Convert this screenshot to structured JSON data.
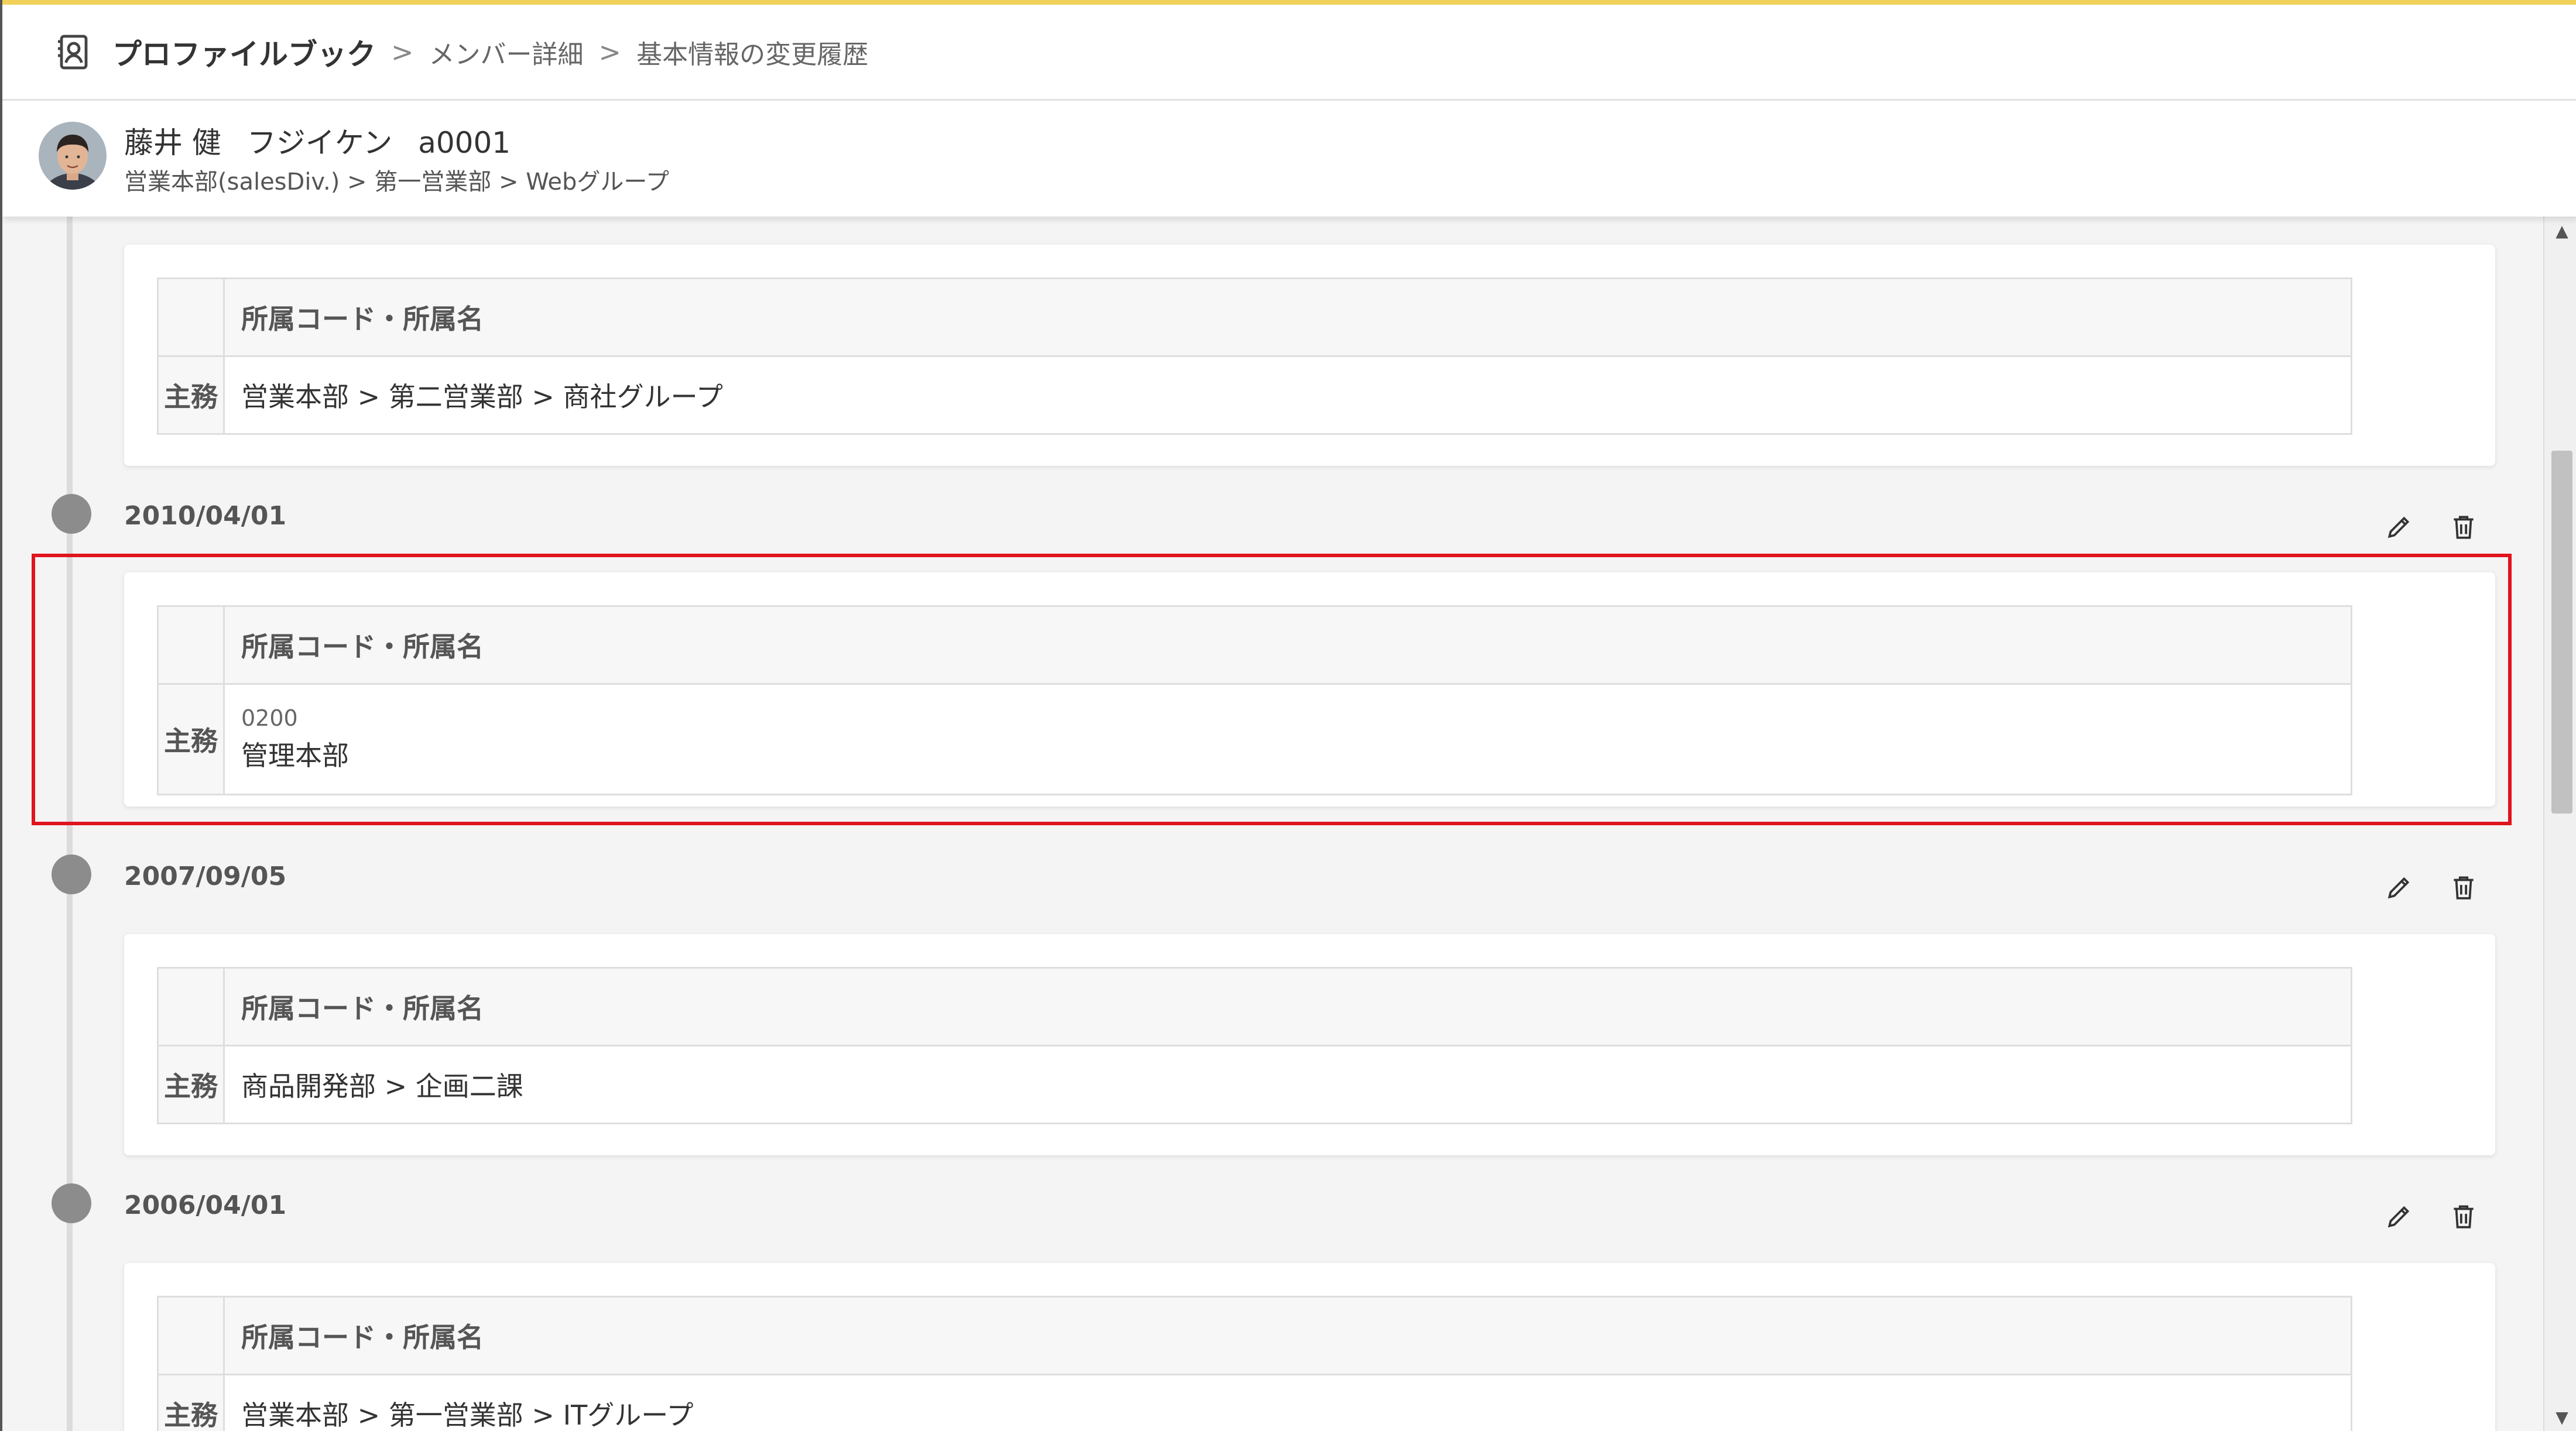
{
  "header": {
    "app_title": "プロファイルブック",
    "breadcrumbs": [
      "メンバー詳細",
      "基本情報の変更履歴"
    ],
    "sep": ">"
  },
  "member": {
    "name": "藤井 健",
    "kana": "フジイケン",
    "code": "a0001",
    "path": "営業本部(salesDiv.) > 第一営業部 > Webグループ"
  },
  "table_header": "所属コード・所属名",
  "row_label": "主務",
  "entries": [
    {
      "date": "",
      "code": "",
      "name": "営業本部 > 第二営業部 > 商社グループ"
    },
    {
      "date": "2010/04/01",
      "code": "0200",
      "name": "管理本部"
    },
    {
      "date": "2007/09/05",
      "code": "",
      "name": "商品開発部 > 企画二課"
    },
    {
      "date": "2006/04/01",
      "code": "",
      "name": "営業本部 > 第一営業部 > ITグループ"
    }
  ],
  "icons": {
    "app": "profile-book-icon",
    "edit": "pencil-icon",
    "delete": "trash-icon"
  },
  "colors": {
    "accent": "#f2d15a",
    "highlight": "#e0141e",
    "timeline_dot": "#8c8c8c"
  }
}
